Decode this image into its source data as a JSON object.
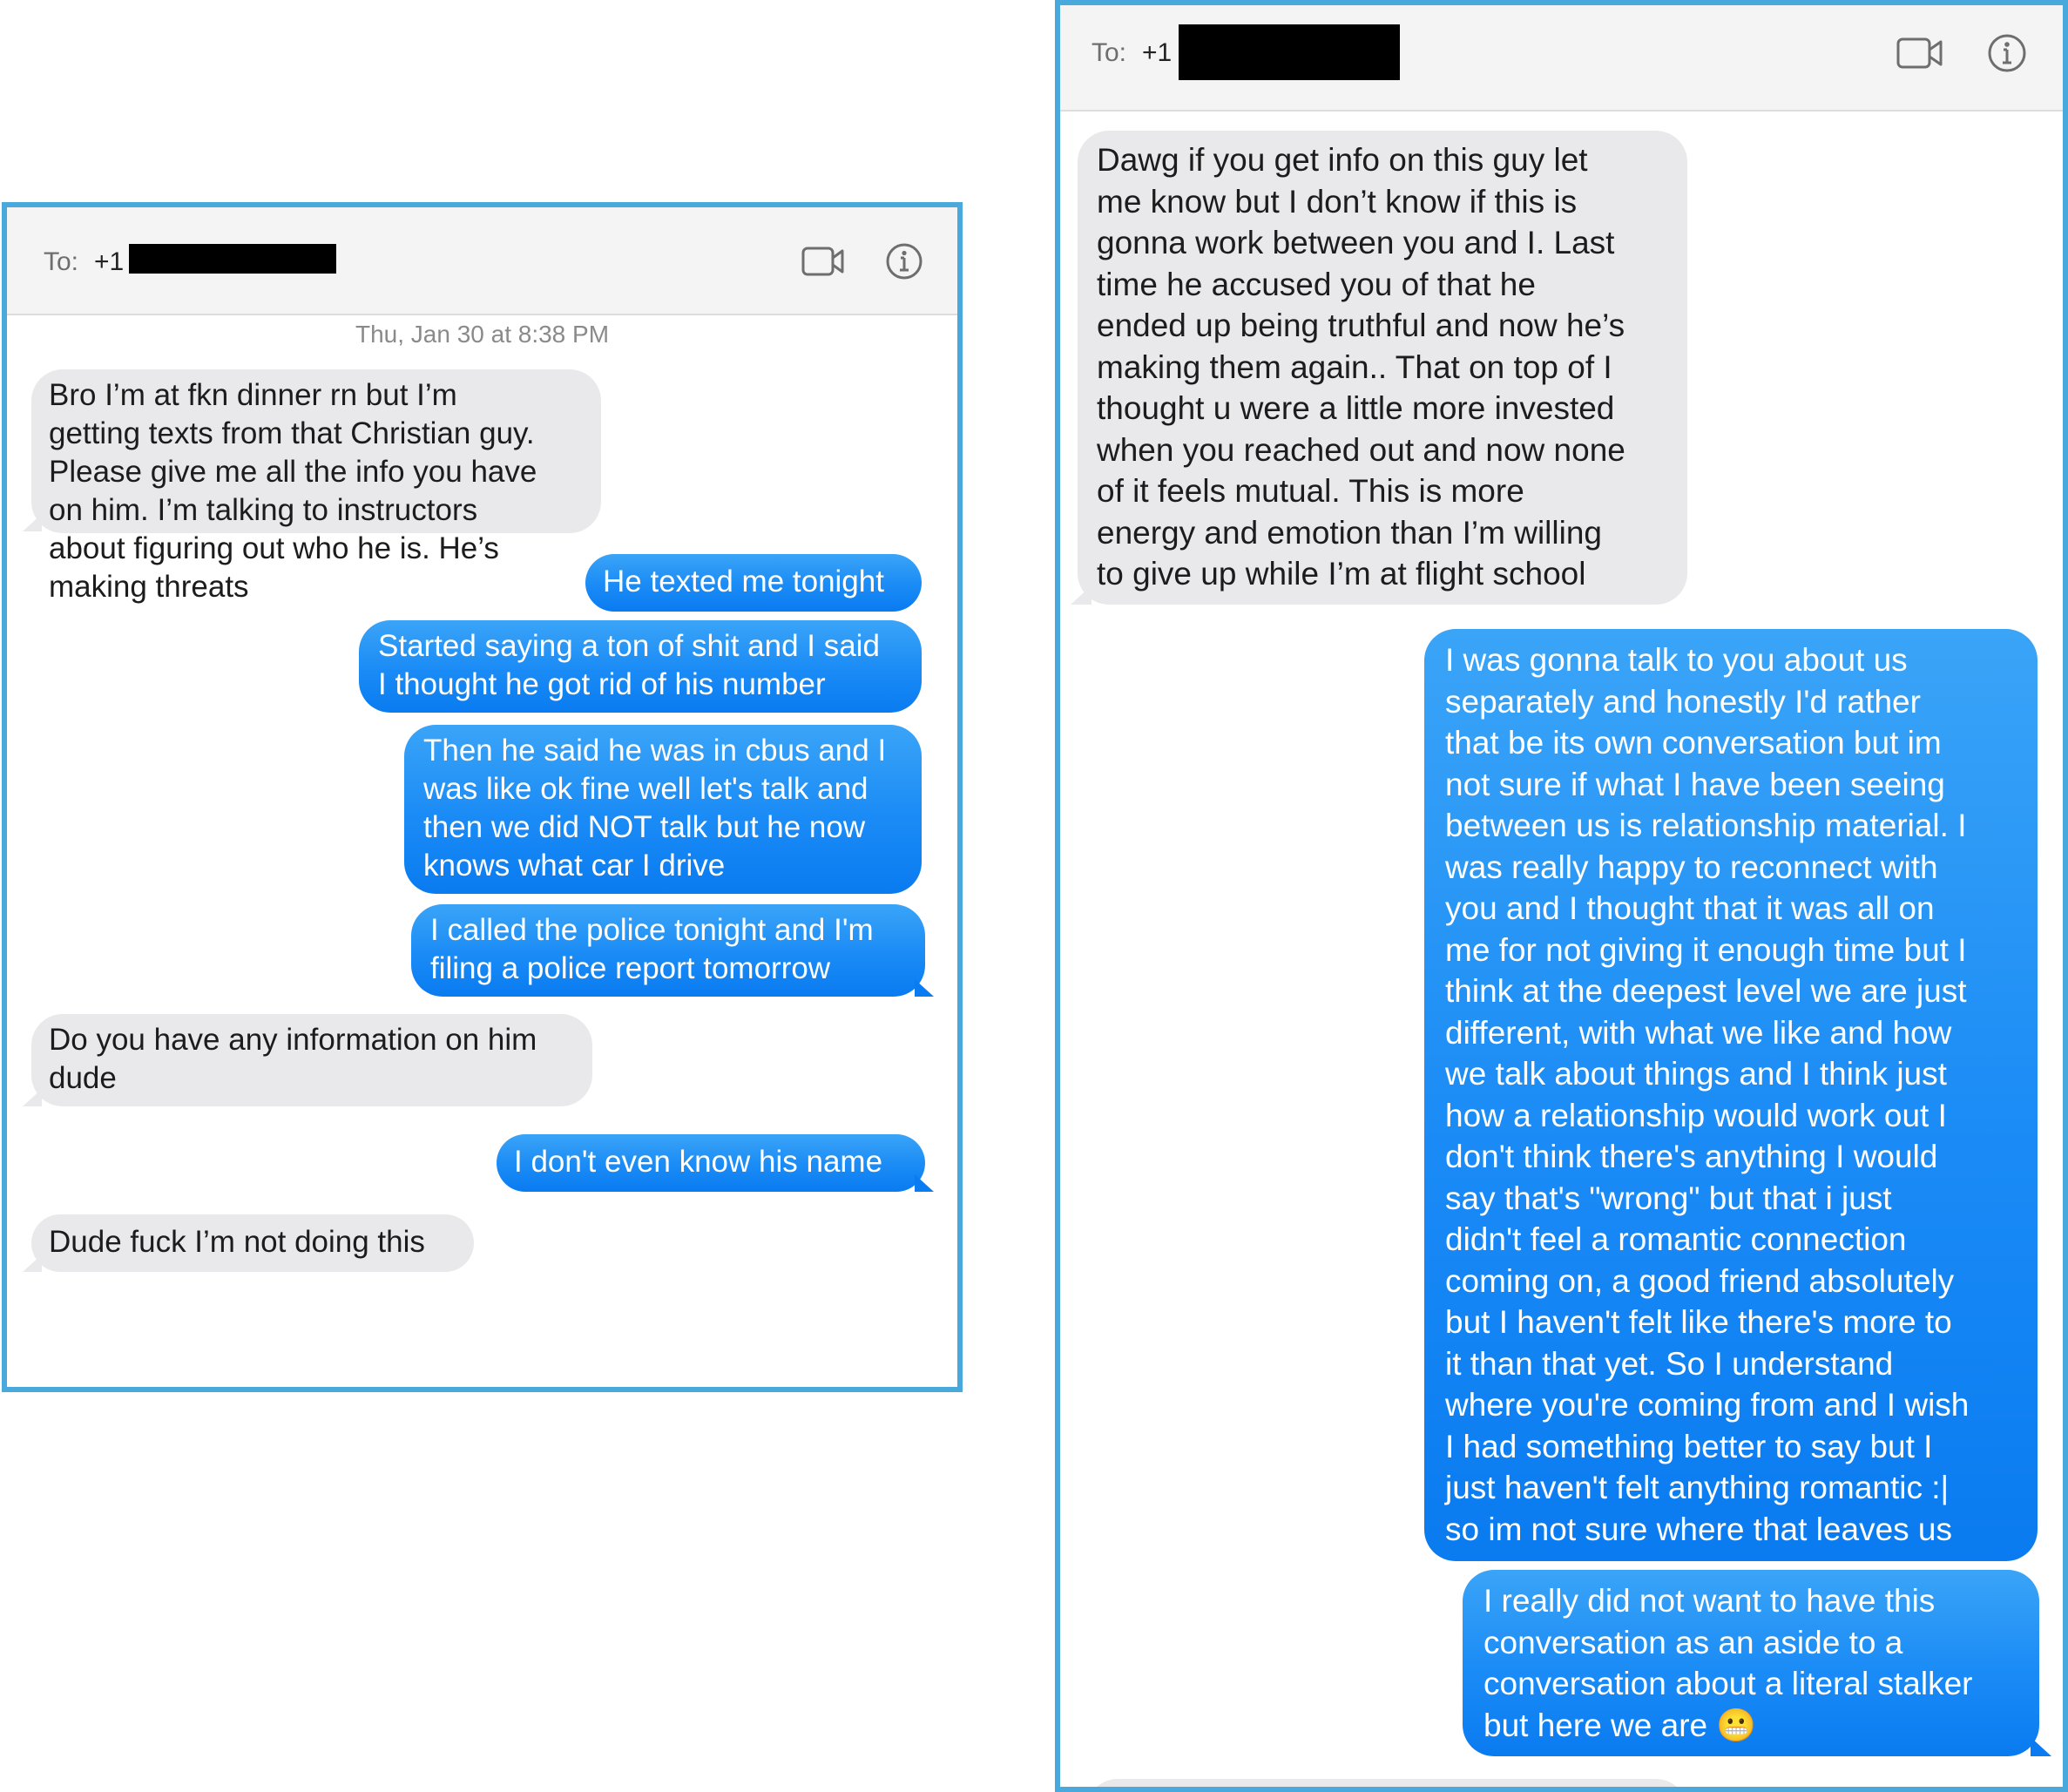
{
  "left": {
    "to_label": "To:",
    "to_number": "+1",
    "timestamp": "Thu, Jan 30 at 8:38 PM",
    "messages": [
      {
        "dir": "in",
        "lines": [
          "Bro I’m at fkn dinner rn but I’m",
          "getting texts from that Christian guy.",
          "Please give me all the info you have",
          "on him. I’m talking to instructors",
          "about figuring out who he is. He’s",
          "making threats"
        ]
      },
      {
        "dir": "out",
        "lines": [
          "He texted me tonight"
        ]
      },
      {
        "dir": "out",
        "lines": [
          "Started saying a ton of shit and I said",
          "I thought he got rid of his number"
        ]
      },
      {
        "dir": "out",
        "lines": [
          "Then he said he was in cbus and I",
          "was like ok fine well let's talk and",
          "then we did NOT talk but he now",
          "knows what car I drive"
        ]
      },
      {
        "dir": "out",
        "lines": [
          "I called the police tonight and I'm",
          "filing a police report tomorrow"
        ]
      },
      {
        "dir": "in",
        "lines": [
          "Do you have any information on him",
          "dude"
        ]
      },
      {
        "dir": "out",
        "lines": [
          "I don't even know his name"
        ]
      },
      {
        "dir": "in",
        "lines": [
          "Dude fuck I’m not doing this"
        ]
      }
    ]
  },
  "right": {
    "to_label": "To:",
    "to_number": "+1",
    "messages": [
      {
        "dir": "in",
        "lines": [
          "Dawg if you get info on this guy let",
          "me know but I don’t know if this is",
          "gonna work between you and I. Last",
          "time he accused you of that he",
          "ended up being truthful and now he’s",
          "making them again.. That on top of I",
          "thought u were a little more invested",
          "when you reached out and now none",
          "of it feels mutual. This is more",
          "energy and emotion than I’m willing",
          "to give up while I’m at flight school"
        ]
      },
      {
        "dir": "out",
        "lines": [
          "I was gonna talk to you about us",
          "separately and honestly I'd rather",
          "that be its own conversation but im",
          "not sure if what I have been seeing",
          "between us is relationship material. I",
          "was really happy to reconnect with",
          "you and I thought that it was all on",
          "me for not giving it enough time but I",
          "think at the deepest level we are just",
          "different, with what we like and how",
          "we talk about things and I think just",
          "how a relationship would work out I",
          "don't think there's anything I would",
          "say that's \"wrong\" but that i just",
          "didn't feel a romantic connection",
          "coming on, a good friend absolutely",
          "but I haven't felt like there's more to",
          "it than that yet. So I understand",
          "where you're coming from and I wish",
          "I had something better to say but I",
          "just haven't felt anything romantic :|",
          "so im not sure where that leaves us"
        ]
      },
      {
        "dir": "out",
        "lines": [
          "I really did not want to have this",
          "conversation as an aside to a",
          "conversation about a literal stalker",
          "but here we are"
        ],
        "emoji": "😬"
      }
    ]
  },
  "icons": {
    "video": "video-camera-icon",
    "info": "info-icon"
  },
  "colors": {
    "outgoing_bubble": "#1a8bf6",
    "incoming_bubble": "#e9e9eb",
    "panel_border": "#4aa9dc",
    "header_bg": "#f4f4f4",
    "redaction": "#000000"
  }
}
